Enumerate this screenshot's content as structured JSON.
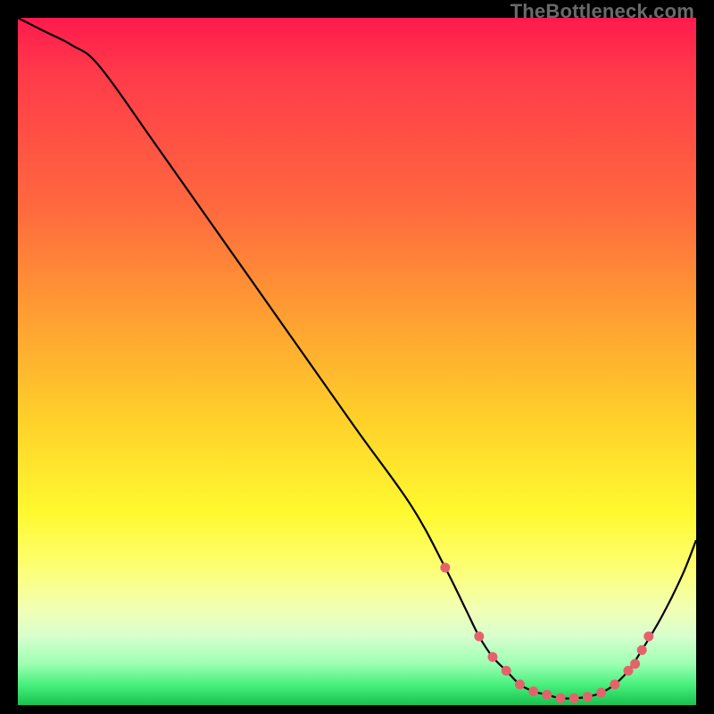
{
  "watermark": "TheBottleneck.com",
  "chart_data": {
    "type": "line",
    "title": "",
    "xlabel": "",
    "ylabel": "",
    "xlim": [
      0,
      100
    ],
    "ylim": [
      0,
      100
    ],
    "series": [
      {
        "name": "bottleneck-curve",
        "x": [
          0,
          4,
          8,
          12,
          20,
          30,
          40,
          50,
          58,
          63,
          66,
          68,
          70,
          72,
          74,
          76,
          78,
          80,
          82,
          84,
          86,
          88,
          90,
          92,
          95,
          98,
          100
        ],
        "y": [
          100,
          98,
          96,
          93,
          82,
          68,
          54,
          40,
          29,
          20,
          14,
          10,
          7,
          5,
          3,
          2,
          1.5,
          1,
          1,
          1.2,
          1.8,
          3,
          5,
          8,
          13,
          19,
          24
        ]
      }
    ],
    "scatter": {
      "name": "highlight-points",
      "color": "#e4636b",
      "x": [
        63,
        68,
        70,
        72,
        74,
        76,
        78,
        80,
        82,
        84,
        86,
        88,
        90,
        91,
        92,
        93
      ],
      "y": [
        20,
        10,
        7,
        5,
        3,
        2,
        1.5,
        1,
        1,
        1.2,
        1.8,
        3,
        5,
        6,
        8,
        10
      ]
    },
    "gradient_stops": [
      {
        "pos": 0.0,
        "color": "#ff1a4d"
      },
      {
        "pos": 0.28,
        "color": "#ff6a3e"
      },
      {
        "pos": 0.58,
        "color": "#ffcf2a"
      },
      {
        "pos": 0.8,
        "color": "#fdff73"
      },
      {
        "pos": 0.94,
        "color": "#9dffb2"
      },
      {
        "pos": 1.0,
        "color": "#17c24d"
      }
    ]
  }
}
